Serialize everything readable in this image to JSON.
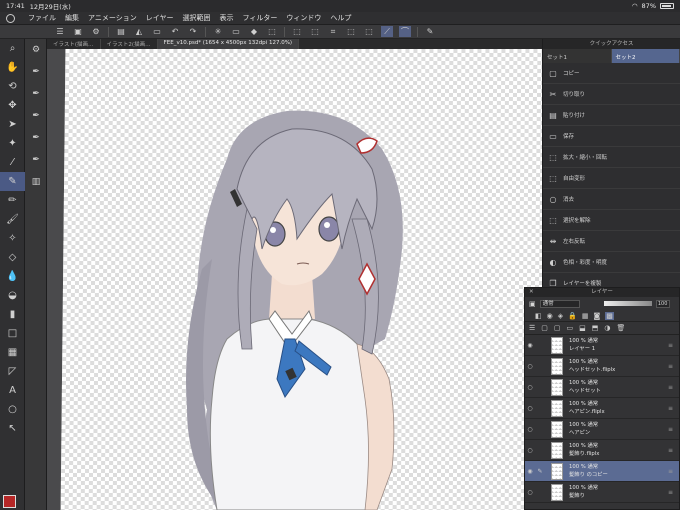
{
  "status": {
    "time": "17:41",
    "date": "12月29日(水)",
    "battery": "87%"
  },
  "menu": [
    "ファイル",
    "編集",
    "アニメーション",
    "レイヤー",
    "選択範囲",
    "表示",
    "フィルター",
    "ウィンドウ",
    "ヘルプ"
  ],
  "tabs": [
    {
      "label": "イラスト(描画…"
    },
    {
      "label": "イラスト2(描画…"
    },
    {
      "label": "FEE_v10.psd* (1654 x 4500px 132dpi 127.0%)"
    }
  ],
  "quick_access": {
    "title": "クイックアクセス",
    "sets": [
      "セット1",
      "セット2"
    ],
    "items": [
      "コピー",
      "切り取り",
      "貼り付け",
      "保存",
      "拡大・縮小・回転",
      "自由変形",
      "消去",
      "選択を解除",
      "左右反転",
      "色相・彩度・明度",
      "レイヤーを複製"
    ]
  },
  "layer_panel": {
    "title": "レイヤー",
    "blend_mode": "通常",
    "opacity": "100",
    "layers": [
      {
        "props": "100 % 通常",
        "name": "レイヤー 1"
      },
      {
        "props": "100 % 通常",
        "name": "ヘッドセット.fliplx"
      },
      {
        "props": "100 % 通常",
        "name": "ヘッドセット"
      },
      {
        "props": "100 % 通常",
        "name": "ヘアピン.fliplx"
      },
      {
        "props": "100 % 通常",
        "name": "ヘアピン"
      },
      {
        "props": "100 % 通常",
        "name": "髪飾り.fliplx"
      },
      {
        "props": "100 % 通常",
        "name": "髪飾り のコピー"
      },
      {
        "props": "100 % 通常",
        "name": "髪飾り"
      }
    ]
  },
  "colors": {
    "main_color": "#b52727",
    "sub_color": "#ffffff",
    "accent": "#55668f"
  }
}
